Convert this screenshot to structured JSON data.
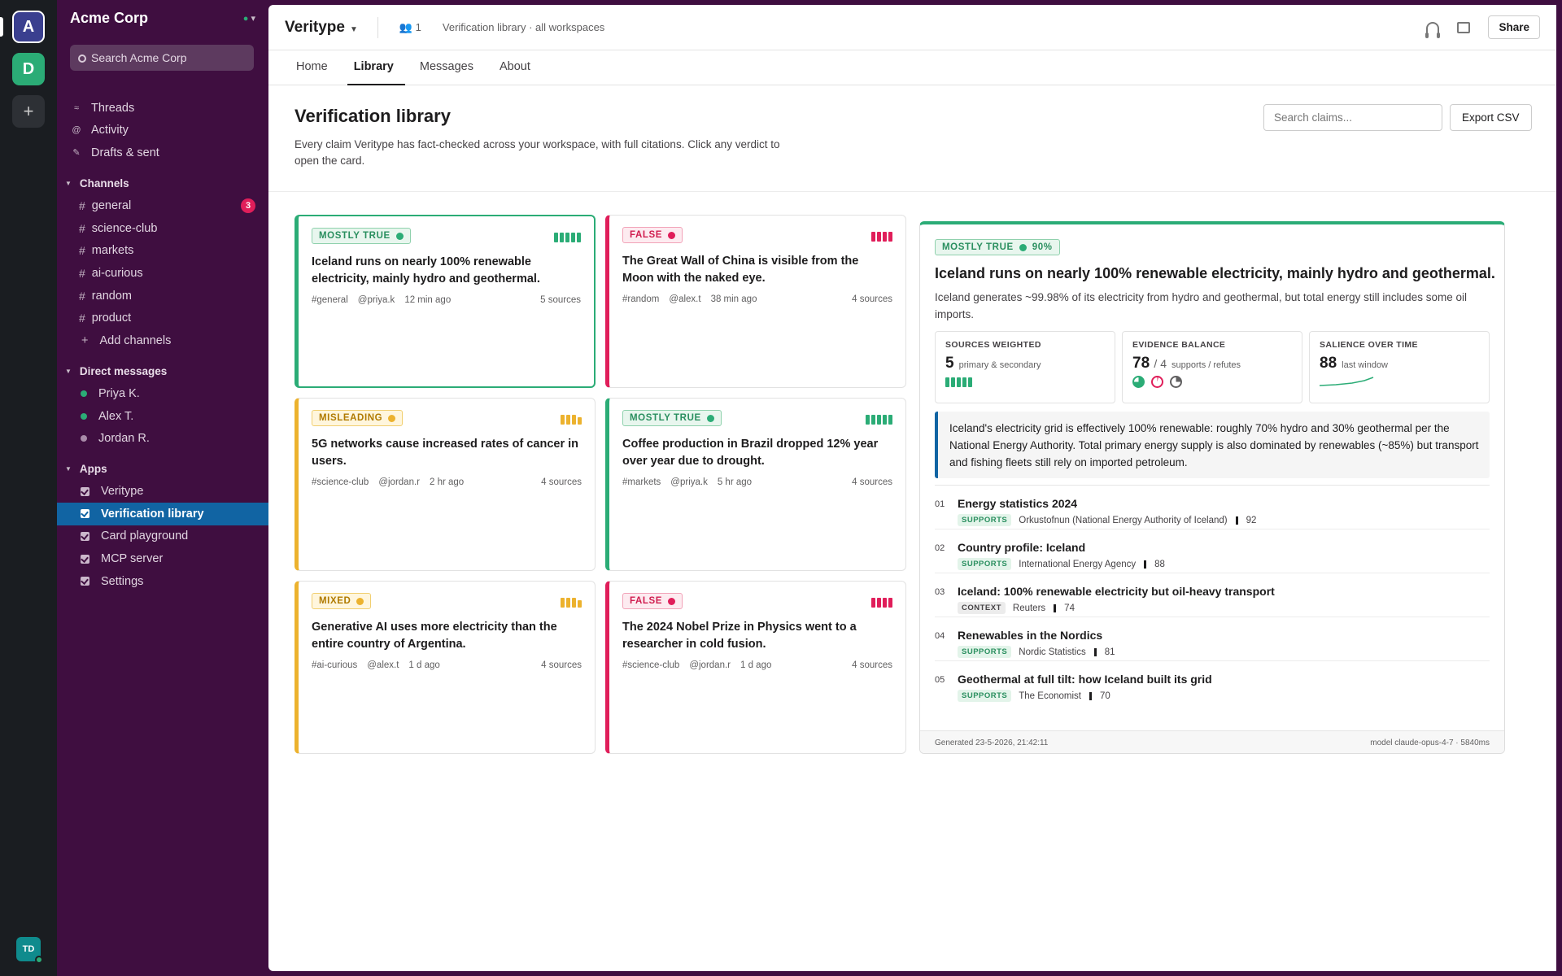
{
  "rail": {
    "workspaces": [
      "A",
      "D"
    ],
    "add": "+",
    "me": "TD"
  },
  "sidebar": {
    "workspace": "Acme Corp",
    "search_placeholder": "Search Acme Corp",
    "nav": [
      {
        "label": "Threads",
        "icon": "threads-icon",
        "glyph": "≈"
      },
      {
        "label": "Activity",
        "icon": "at-icon",
        "glyph": "@"
      },
      {
        "label": "Drafts & sent",
        "icon": "pencil-icon",
        "glyph": "✎"
      }
    ],
    "channels_header": "Channels",
    "channels": [
      {
        "name": "general",
        "badge": "3"
      },
      {
        "name": "science-club"
      },
      {
        "name": "markets"
      },
      {
        "name": "ai-curious"
      },
      {
        "name": "random"
      },
      {
        "name": "product"
      }
    ],
    "add_channels": "Add channels",
    "dm_header": "Direct messages",
    "dms": [
      {
        "name": "Priya K.",
        "color": "#2bac76"
      },
      {
        "name": "Alex T.",
        "color": "#2bac76"
      },
      {
        "name": "Jordan R.",
        "color": "#a98ba9"
      }
    ],
    "apps_header": "Apps",
    "apps": [
      "Veritype",
      "Verification library",
      "Card playground",
      "MCP server",
      "Settings"
    ],
    "active_app": "Verification library"
  },
  "topbar": {
    "app": "Veritype",
    "members": "1",
    "crumb": "Verification library · all workspaces",
    "share": "Share"
  },
  "tabs": [
    "Home",
    "Library",
    "Messages",
    "About"
  ],
  "active_tab": "Library",
  "page": {
    "title": "Verification library",
    "subtitle": "Every claim Veritype has fact-checked across your workspace, with full citations. Click any verdict to open the card.",
    "search_placeholder": "Search claims...",
    "export": "Export CSV"
  },
  "colors": {
    "true": "#2bac76",
    "false": "#e01e5a",
    "misleading": "#ecb22e",
    "accent": "#1164a3"
  },
  "cards": [
    {
      "verdict": "MOSTLY TRUE",
      "kind": "true",
      "claim": "Iceland runs on nearly 100% renewable electricity, mainly hydro and geothermal.",
      "channel": "#general",
      "author": "@priya.k",
      "time": "12 min ago",
      "sources": "5 sources",
      "selected": true
    },
    {
      "verdict": "FALSE",
      "kind": "false",
      "claim": "The Great Wall of China is visible from the Moon with the naked eye.",
      "channel": "#random",
      "author": "@alex.t",
      "time": "38 min ago",
      "sources": "4 sources"
    },
    {
      "verdict": "MISLEADING",
      "kind": "mis",
      "claim": "5G networks cause increased rates of cancer in users.",
      "channel": "#science-club",
      "author": "@jordan.r",
      "time": "2 hr ago",
      "sources": "4 sources"
    },
    {
      "verdict": "MOSTLY TRUE",
      "kind": "true",
      "claim": "Coffee production in Brazil dropped 12% year over year due to drought.",
      "channel": "#markets",
      "author": "@priya.k",
      "time": "5 hr ago",
      "sources": "4 sources"
    },
    {
      "verdict": "MIXED",
      "kind": "mis",
      "claim": "Generative AI uses more electricity than the entire country of Argentina.",
      "channel": "#ai-curious",
      "author": "@alex.t",
      "time": "1 d ago",
      "sources": "4 sources"
    },
    {
      "verdict": "FALSE",
      "kind": "false",
      "claim": "The 2024 Nobel Prize in Physics went to a researcher in cold fusion.",
      "channel": "#science-club",
      "author": "@jordan.r",
      "time": "1 d ago",
      "sources": "4 sources"
    }
  ],
  "detail": {
    "verdict": "MOSTLY TRUE",
    "confidence": "90%",
    "title": "Iceland runs on nearly 100% renewable electricity, mainly hydro and geothermal.",
    "summary": "Iceland generates ~99.98% of its electricity from hydro and geothermal, but total energy still includes some oil imports.",
    "stats": [
      {
        "label": "SOURCES WEIGHTED",
        "value": "5",
        "extra": "primary & secondary"
      },
      {
        "label": "EVIDENCE BALANCE",
        "value": "78",
        "slash": "/ 4",
        "extra": "supports / refutes"
      },
      {
        "label": "SALIENCE OVER TIME",
        "value": "88",
        "extra": "last window"
      }
    ],
    "quote": "Iceland's electricity grid is effectively 100% renewable: roughly 70% hydro and 30% geothermal per the National Energy Authority. Total primary energy supply is also dominated by renewables (~85%) but transport and fishing fleets still rely on imported petroleum.",
    "sources": [
      {
        "n": "01",
        "title": "Energy statistics 2024",
        "tag": "SUPPORTS",
        "pub": "Orkustofnun (National Energy Authority of Iceland)",
        "score": "92"
      },
      {
        "n": "02",
        "title": "Country profile: Iceland",
        "tag": "SUPPORTS",
        "pub": "International Energy Agency",
        "score": "88"
      },
      {
        "n": "03",
        "title": "Iceland: 100% renewable electricity but oil-heavy transport",
        "tag": "CONTEXT",
        "pub": "Reuters",
        "score": "74"
      },
      {
        "n": "04",
        "title": "Renewables in the Nordics",
        "tag": "SUPPORTS",
        "pub": "Nordic Statistics",
        "score": "81"
      },
      {
        "n": "05",
        "title": "Geothermal at full tilt: how Iceland built its grid",
        "tag": "SUPPORTS",
        "pub": "The Economist",
        "score": "70"
      }
    ],
    "generated": "Generated 23-5-2026, 21:42:11",
    "model": "model claude-opus-4-7 · 5840ms"
  }
}
